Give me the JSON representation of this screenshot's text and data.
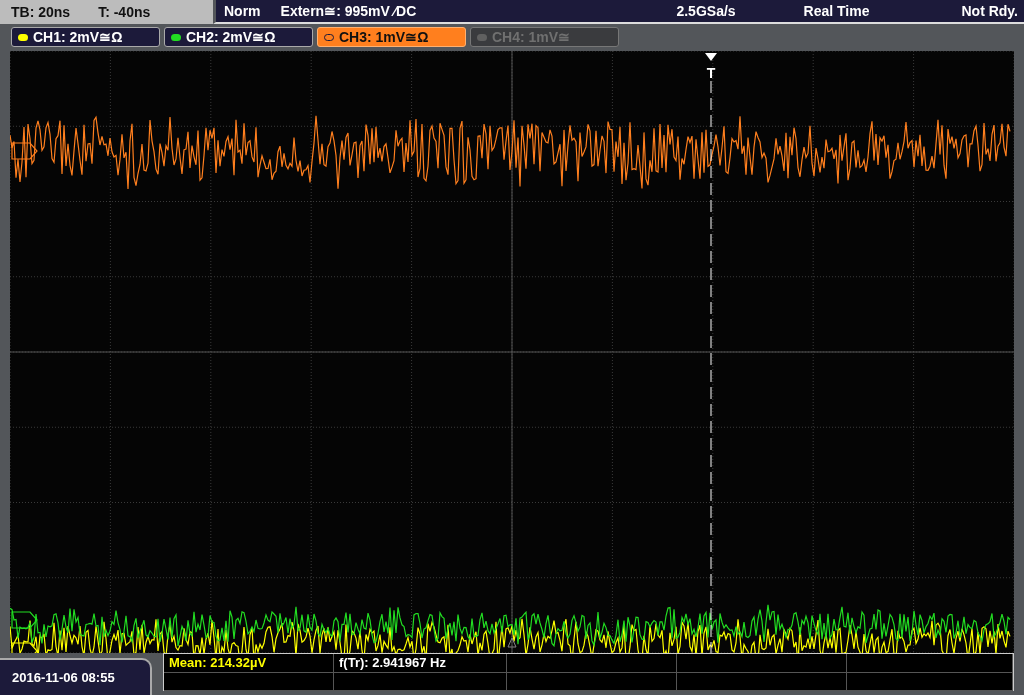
{
  "status_bar": {
    "timebase": "TB: 20ns",
    "trigger_time": "T: -40ns",
    "mode": "Norm",
    "trigger_source": "Extern≅: 995mV ⁄DC",
    "sample_rate": "2.5GSa/s",
    "acquisition": "Real Time",
    "state": "Not Rdy."
  },
  "channels": [
    {
      "label": "CH1: 2mV≅Ω",
      "color": "#ffff00",
      "selected": false,
      "enabled": true
    },
    {
      "label": "CH2: 2mV≅Ω",
      "color": "#22dd22",
      "selected": false,
      "enabled": true
    },
    {
      "label": "CH3: 1mV≅Ω",
      "color": "#ff7f1e",
      "selected": true,
      "enabled": true
    },
    {
      "label": "CH4: 1mV≅",
      "color": "#606060",
      "selected": false,
      "enabled": false
    }
  ],
  "trigger_marker": "T",
  "date_time": "2016-11-06 08:55",
  "measurements": [
    {
      "text": "Mean: 214.32µV",
      "kind": "channel"
    },
    {
      "text": "f(Tr): 2.941967 Hz",
      "kind": "plain"
    }
  ]
}
